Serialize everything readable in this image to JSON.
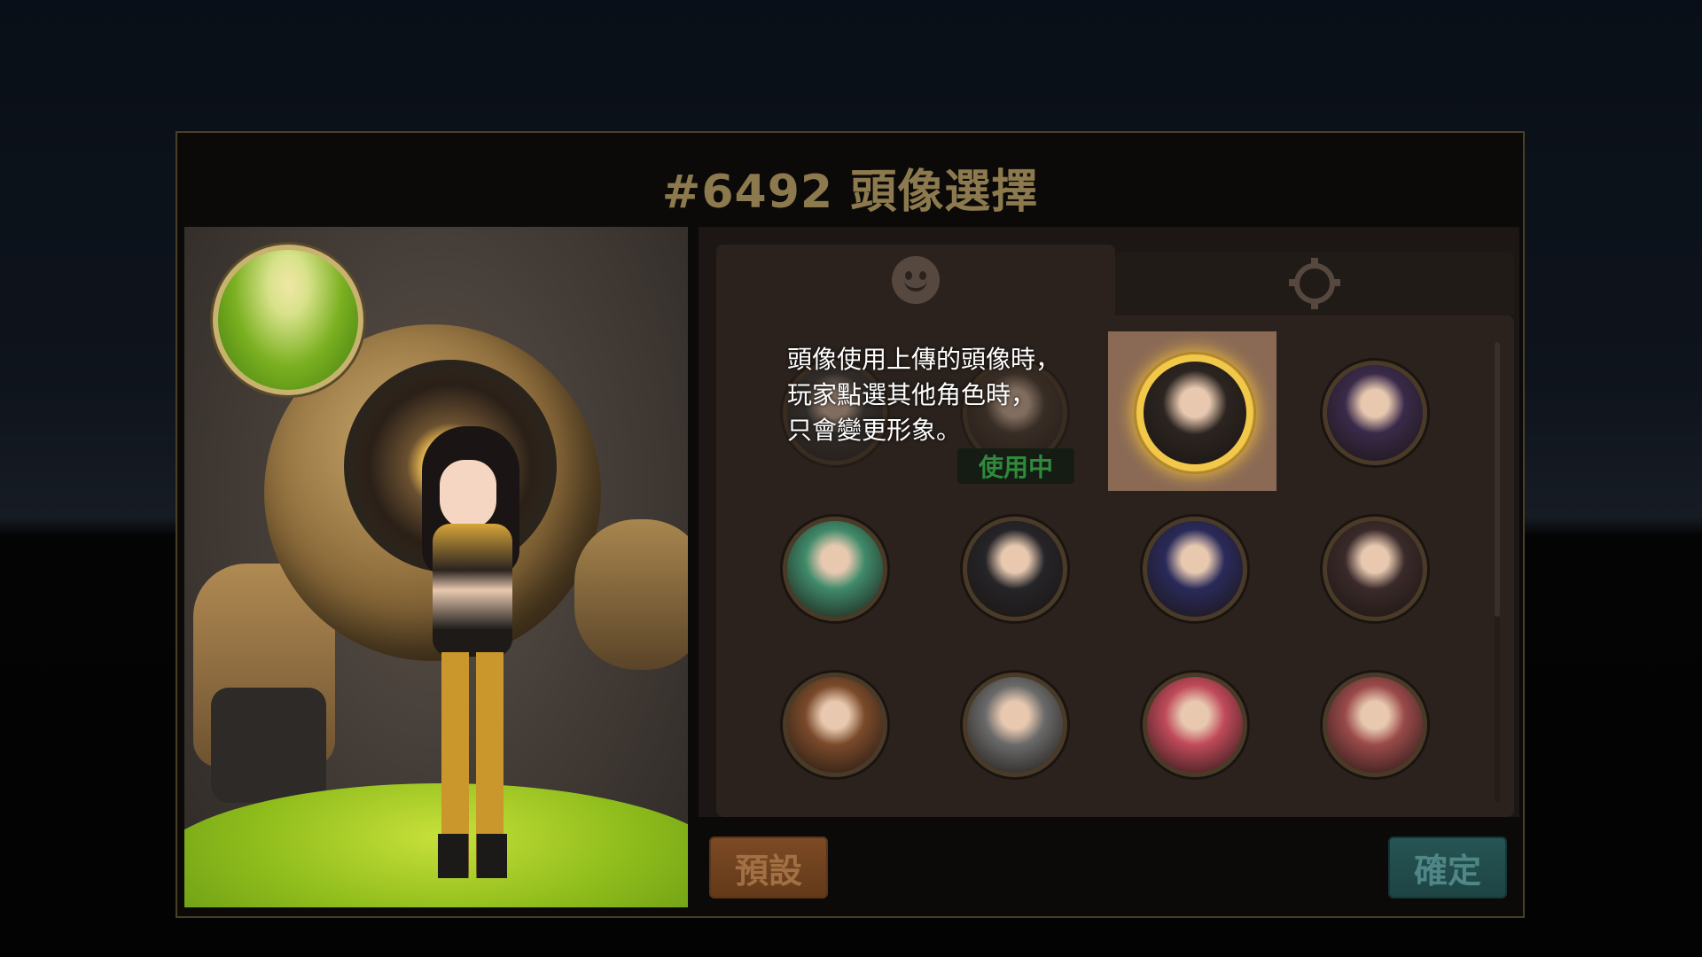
{
  "dialog": {
    "title": "#6492 頭像選擇"
  },
  "tabs": [
    {
      "icon": "smile-icon",
      "active": true
    },
    {
      "icon": "gear-icon",
      "active": false
    }
  ],
  "avatars": [
    {
      "id": "uploaded",
      "desc": "dim-avatar",
      "color": "#3a3a3a"
    },
    {
      "id": "current",
      "desc": "dim-avatar",
      "color": "#4a3c30"
    },
    {
      "id": "selected",
      "desc": "girl-goggles",
      "color": "#2b2420"
    },
    {
      "id": "top-hat",
      "desc": "boy-top-hat",
      "color": "#3a2a4a"
    },
    {
      "id": "green-hair",
      "desc": "green-hair-girl",
      "color": "#3f8a6a"
    },
    {
      "id": "hooded",
      "desc": "hooded-figure",
      "color": "#252428"
    },
    {
      "id": "blue-hair",
      "desc": "blue-hair-girl",
      "color": "#2a2a5a"
    },
    {
      "id": "glasses",
      "desc": "man-glasses",
      "color": "#3a2a2a"
    },
    {
      "id": "captain",
      "desc": "blonde-captain",
      "color": "#7a4a2a"
    },
    {
      "id": "old-man",
      "desc": "bearded-old-man",
      "color": "#6a6a6a"
    },
    {
      "id": "pink-hair",
      "desc": "pink-hair-girl",
      "color": "#c04a5a"
    },
    {
      "id": "white-hair",
      "desc": "white-hair-girl",
      "color": "#9a4a4a"
    }
  ],
  "in_use_label": "使用中",
  "tooltip": "頭像使用上傳的頭像時，\n玩家點選其他角色時，\n只會變更形象。",
  "buttons": {
    "default": "預設",
    "confirm": "確定"
  },
  "colors": {
    "selected_ring": "#f2c84a",
    "in_use_text": "#2f8a3c"
  }
}
